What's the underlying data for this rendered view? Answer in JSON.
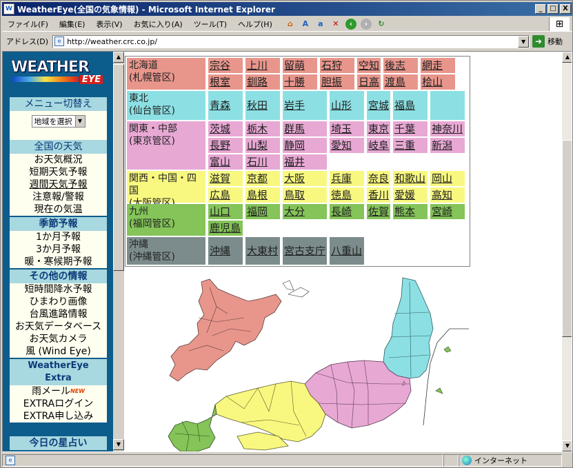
{
  "window": {
    "title": "WeatherEye(全国の気象情報) - Microsoft Internet Explorer",
    "controls": {
      "minimize": "_",
      "maximize": "□",
      "close": "X"
    }
  },
  "menu": [
    "ファイル(F)",
    "編集(E)",
    "表示(V)",
    "お気に入り(A)",
    "ツール(T)",
    "ヘルプ(H)"
  ],
  "address": {
    "label": "アドレス(D)",
    "url": "http://weather.crc.co.jp/",
    "go_label": "移動"
  },
  "nav": {
    "logo_top": "WEATHER",
    "logo_bottom": "EYE",
    "menu_switch": {
      "title": "メニュー切替え",
      "select_value": "地域を選択"
    },
    "national": {
      "title": "全国の天気",
      "items": [
        "お天気概況",
        "短期天気予報",
        "週間天気予報",
        "注意報/警報",
        "現在の気温"
      ]
    },
    "season": {
      "title": "季節予報",
      "items": [
        "1か月予報",
        "3か月予報",
        "暖・寒候期予報"
      ]
    },
    "other": {
      "title": "その他の情報",
      "items": [
        "短時間降水予報",
        "ひまわり画像",
        "台風進路情報",
        "お天気データベース",
        "お天気カメラ",
        "風 (Wind Eye)"
      ]
    },
    "extra": {
      "title_line1": "WeatherEye",
      "title_line2": "Extra",
      "items": [
        "雨メール",
        "EXTRAログイン",
        "EXTRA申し込み"
      ],
      "new_badge": "NEW"
    },
    "horoscope": {
      "title": "今日の星占い"
    }
  },
  "regions": [
    {
      "name": "北海道",
      "sub": "(札幌管区)",
      "color": "#e8968c",
      "prefs": [
        "宗谷",
        "上川",
        "留萌",
        "石狩",
        "空知",
        "後志",
        "網走",
        "根室",
        "釧路",
        "十勝",
        "胆振",
        "日高",
        "渡島",
        "桧山"
      ]
    },
    {
      "name": "東北",
      "sub": "(仙台管区)",
      "color": "#8ce0e4",
      "prefs": [
        "青森",
        "秋田",
        "岩手",
        "山形",
        "宮城",
        "福島",
        ""
      ]
    },
    {
      "name": "関東・中部",
      "sub": "(東京管区)",
      "color": "#e8a8d4",
      "prefs": [
        "茨城",
        "栃木",
        "群馬",
        "埼玉",
        "東京",
        "千葉",
        "神奈川",
        "長野",
        "山梨",
        "静岡",
        "愛知",
        "岐阜",
        "三重",
        "新潟",
        "富山",
        "石川",
        "福井"
      ]
    },
    {
      "name": "関西・中国・四国",
      "sub": "(大阪管区)",
      "color": "#f8f880",
      "prefs": [
        "滋賀",
        "京都",
        "大阪",
        "兵庫",
        "奈良",
        "和歌山",
        "岡山",
        "広島",
        "島根",
        "鳥取",
        "徳島",
        "香川",
        "愛媛",
        "高知"
      ]
    },
    {
      "name": "九州",
      "sub": "(福岡管区)",
      "color": "#84c458",
      "prefs": [
        "山口",
        "福岡",
        "大分",
        "長崎",
        "佐賀",
        "熊本",
        "宮崎",
        "鹿児島"
      ]
    },
    {
      "name": "沖縄",
      "sub": "(沖縄管区)",
      "color": "#7c8c8c",
      "prefs": [
        "沖縄",
        "大東村",
        "宮古支庁",
        "八重山"
      ]
    }
  ],
  "status": {
    "zone": "インターネット"
  },
  "colors": {
    "nav_bg": "#0c5c8c",
    "nav_head": "#a8d8e0",
    "titlebar": "#0a246a"
  }
}
